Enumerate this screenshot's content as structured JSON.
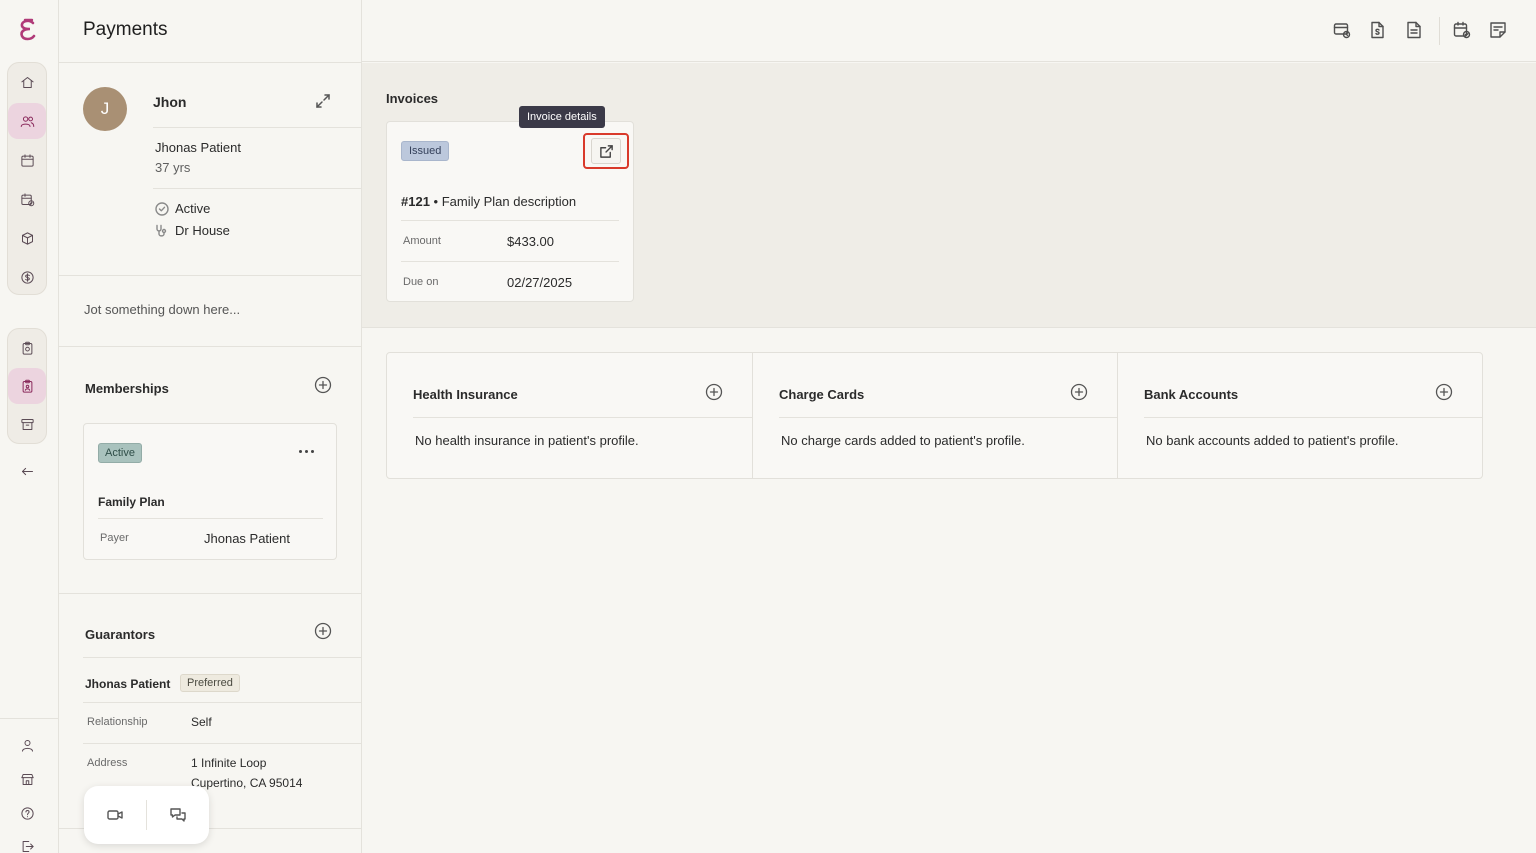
{
  "colors": {
    "accent": "#8a2a5c",
    "active_nav_bg": "#ecd4df",
    "highlight": "#d93a2b",
    "tooltip_bg": "#3b3a48"
  },
  "rail": {
    "group1": [
      "home-icon",
      "users-icon",
      "calendar-icon",
      "calendar-check-icon",
      "box-icon",
      "dollar-icon"
    ],
    "group2": [
      "clipboard-icon",
      "clipboard-user-icon",
      "archive-icon"
    ],
    "bottom": [
      "user-icon",
      "store-icon",
      "help-icon",
      "logout-icon"
    ]
  },
  "panel": {
    "title": "Payments",
    "patient": {
      "initial": "J",
      "name": "Jhon",
      "full_name": "Jhonas Patient",
      "age": "37 yrs",
      "status": "Active",
      "doctor": "Dr House"
    },
    "note_placeholder": "Jot something down here...",
    "memberships": {
      "title": "Memberships",
      "card": {
        "badge": "Active",
        "plan": "Family Plan",
        "payer_label": "Payer",
        "payer_value": "Jhonas Patient"
      }
    },
    "guarantors": {
      "title": "Guarantors",
      "name": "Jhonas Patient",
      "badge": "Preferred",
      "relationship_label": "Relationship",
      "relationship_value": "Self",
      "address_label": "Address",
      "address_line1": "1 Infinite Loop",
      "address_line2": "Cupertino, CA 95014"
    }
  },
  "main": {
    "invoices": {
      "title": "Invoices",
      "card": {
        "badge": "Issued",
        "tooltip": "Invoice details",
        "number": "#121",
        "separator": "•",
        "description": "Family Plan description",
        "amount_label": "Amount",
        "amount_value": "$433.00",
        "due_label": "Due on",
        "due_value": "02/27/2025"
      }
    },
    "health_insurance": {
      "title": "Health Insurance",
      "empty": "No health insurance in patient's profile."
    },
    "charge_cards": {
      "title": "Charge Cards",
      "empty": "No charge cards added to patient's profile."
    },
    "bank_accounts": {
      "title": "Bank Accounts",
      "empty": "No bank accounts added to patient's profile."
    }
  }
}
